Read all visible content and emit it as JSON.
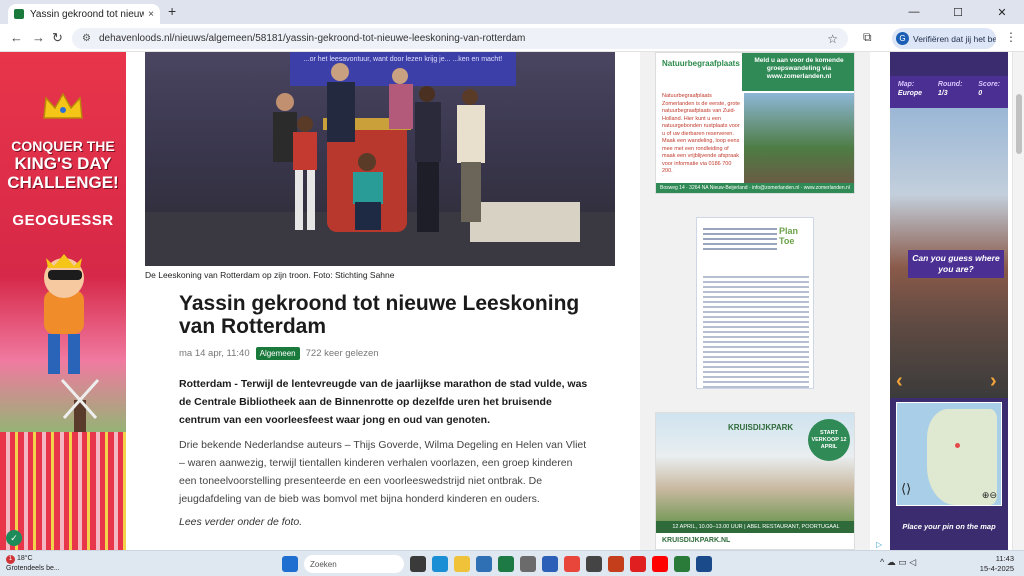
{
  "browser": {
    "tab_title": "Yassin gekroond tot nieuwe Le",
    "tab_close": "×",
    "new_tab": "+",
    "url": "dehavenloods.nl/nieuws/algemeen/58181/yassin-gekroond-tot-nieuwe-leeskoning-van-rotterdam",
    "verify_label": "Verifiëren dat jij het bent",
    "back": "←",
    "forward": "→",
    "reload": "↻",
    "star": "☆",
    "menu": "⋮",
    "ext": "⧉",
    "minimize": "—",
    "maximize": "☐",
    "close": "✕"
  },
  "left_ad": {
    "headline_1": "CONQUER THE",
    "headline_2": "KING'S DAY",
    "headline_3": "CHALLENGE!",
    "logo": "GEOGUESSR"
  },
  "article": {
    "screen_text": "...or het leesavontuur, want door lezen krijg je... ...ken en macht!",
    "caption": "De Leeskoning van Rotterdam op zijn troon. Foto: Stichting Sahne",
    "title": "Yassin gekroond tot nieuwe Leeskoning van Rotterdam",
    "date": "ma 14 apr, 11:40",
    "category": "Algemeen",
    "views": "722 keer gelezen",
    "lead": "Rotterdam - Terwijl de lentevreugde van de jaarlijkse marathon de stad vulde, was de Centrale Bibliotheek aan de Binnenrotte op dezelfde uren het bruisende centrum van een voorleesfeest waar jong en oud van genoten.",
    "paragraph": "Drie bekende Nederlandse auteurs – Thijs Goverde, Wilma Degeling en Helen van Vliet – waren aanwezig, terwijl tientallen kinderen verhalen voorlazen, een groep kinderen een toneelvoorstelling presenteerde en een voorleeswedstrijd niet ontbrak. De jeugdafdeling van de bieb was bomvol met bijna honderd kinderen en ouders.",
    "read_more": "Lees verder onder de foto."
  },
  "sidebar": {
    "ad1_logo": "Natuurbegraafplaats ZOMERLANDEN",
    "ad1_banner": "Meld u aan voor de komende groepswandeling via www.zomerlanden.nl",
    "ad1_text": "Natuurbegraafplaats Zomerlanden is de eerste, grote natuurbegraafplaats van Zuid-Holland. Hier kunt u een natuurgebonden rustplaats voor u of uw dierbaren reserveren. Maak een wandeling, loop eens mee met een rondleiding of maak een vrijblijvende afspraak voor informatie via 0186 700 200.",
    "ad1_footer": "Bosweg 14 · 3264 NA Nieuw-Beijerland · info@zomerlanden.nl · www.zomerlanden.nl",
    "ad2_brand": "Plan Toe",
    "ad3_brand": "KRUISDIJKPARK",
    "ad3_badge": "START VERKOOP 12 APRIL",
    "ad3_bar": "12 APRIL, 10.00–13.00 UUR | ABEL RESTAURANT, POORTUGAAL",
    "ad3_url": "KRUISDIJKPARK.NL"
  },
  "right_ad": {
    "map_label": "Map:",
    "map_value": "Europe",
    "round_label": "Round:",
    "round_value": "1/3",
    "score_label": "Score:",
    "score_value": "0",
    "bubble": "Can you guess where you are?",
    "cta": "Place your pin on the map",
    "zoom": "⊕⊖",
    "adchoice": "▷"
  },
  "taskbar": {
    "temperature": "18°C",
    "weather": "Grotendeels be...",
    "badge": "1",
    "search_placeholder": "Zoeken",
    "time": "11:43",
    "date": "15-4-2025",
    "tray": "^ ☁ ▭ ◁"
  },
  "colors": {
    "green": "#1a7a3c",
    "geoguessr_purple": "#4b2f93"
  }
}
